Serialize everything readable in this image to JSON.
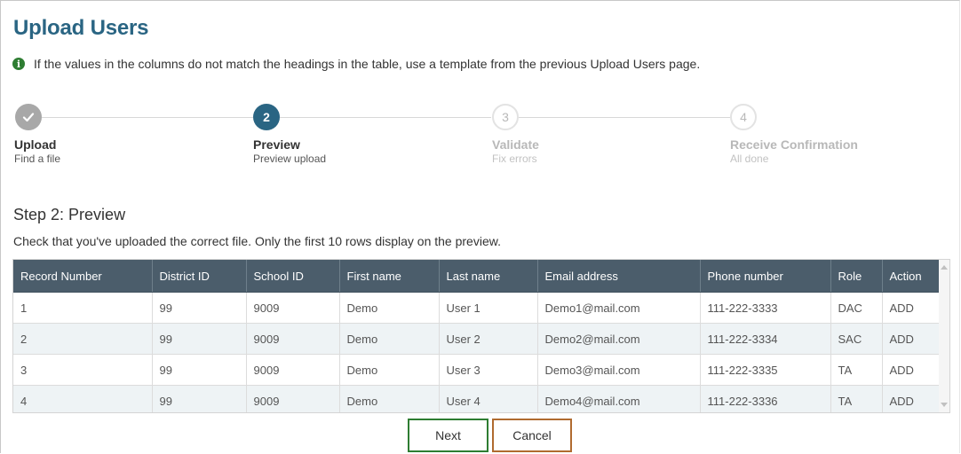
{
  "page": {
    "title": "Upload Users",
    "info": "If the values in the columns do not match the headings in the table, use a template from the previous Upload Users page."
  },
  "stepper": {
    "steps": [
      {
        "number": "",
        "state": "done",
        "label": "Upload",
        "sub": "Find a file"
      },
      {
        "number": "2",
        "state": "current",
        "label": "Preview",
        "sub": "Preview upload"
      },
      {
        "number": "3",
        "state": "future",
        "label": "Validate",
        "sub": "Fix errors"
      },
      {
        "number": "4",
        "state": "future",
        "label": "Receive Confirmation",
        "sub": "All done"
      }
    ]
  },
  "section": {
    "title": "Step 2: Preview",
    "description": "Check that you've uploaded the correct file. Only the first 10 rows display on the preview."
  },
  "table": {
    "columns": [
      "Record Number",
      "District ID",
      "School ID",
      "First name",
      "Last name",
      "Email address",
      "Phone number",
      "Role",
      "Action"
    ],
    "rows": [
      [
        "1",
        "99",
        "9009",
        "Demo",
        "User 1",
        "Demo1@mail.com",
        "111-222-3333",
        "DAC",
        "ADD"
      ],
      [
        "2",
        "99",
        "9009",
        "Demo",
        "User 2",
        "Demo2@mail.com",
        "111-222-3334",
        "SAC",
        "ADD"
      ],
      [
        "3",
        "99",
        "9009",
        "Demo",
        "User 3",
        "Demo3@mail.com",
        "111-222-3335",
        "TA",
        "ADD"
      ],
      [
        "4",
        "99",
        "9009",
        "Demo",
        "User 4",
        "Demo4@mail.com",
        "111-222-3336",
        "TA",
        "ADD"
      ]
    ]
  },
  "buttons": {
    "next": "Next",
    "cancel": "Cancel"
  },
  "colors": {
    "title": "#2a6583",
    "header_bg": "#4b5d6b",
    "info_icon": "#2e7d32",
    "next_border": "#2e7d32",
    "cancel_border": "#b06b2f"
  },
  "icons": {
    "info": "info-circle-icon",
    "done_step": "checkmark-icon"
  }
}
